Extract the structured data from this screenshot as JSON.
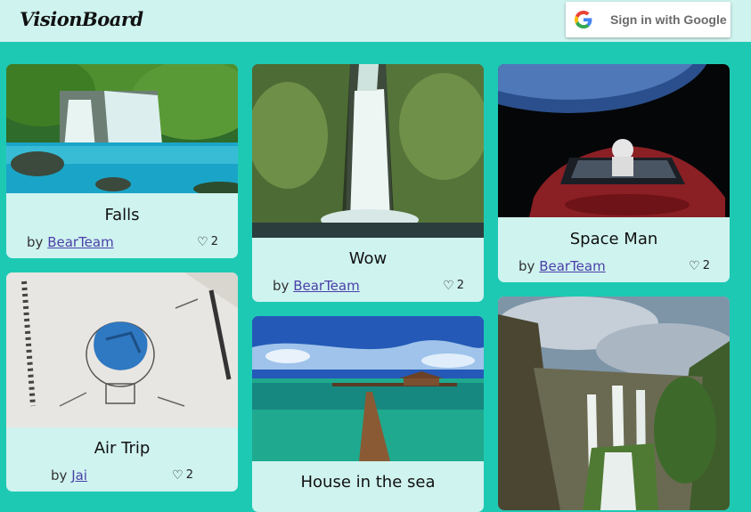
{
  "header": {
    "logo": "VisionBoard",
    "signin_label": "Sign in with Google"
  },
  "cards": [
    {
      "title": "Falls",
      "by": "by",
      "author": "BearTeam",
      "likes": "2",
      "image": "waterfall-lagoon"
    },
    {
      "title": "Wow",
      "by": "by",
      "author": "BearTeam",
      "likes": "2",
      "image": "waterfall-cliff"
    },
    {
      "title": "Space Man",
      "by": "by",
      "author": "BearTeam",
      "likes": "2",
      "image": "car-in-space"
    },
    {
      "title": "Air Trip",
      "by": "by",
      "author": "Jai",
      "likes": "2",
      "image": "crumpled-paper-lightbulb-sketch"
    },
    {
      "title": "House in the sea",
      "image": "overwater-bungalow-pier"
    },
    {
      "title": "",
      "image": "canyon-waterfalls"
    }
  ],
  "icons": {
    "heart": "heart-outline-icon",
    "google": "google-g-icon"
  },
  "colors": {
    "background": "#1ec9b4",
    "card": "#cff3ef",
    "link": "#4b3fa8"
  }
}
